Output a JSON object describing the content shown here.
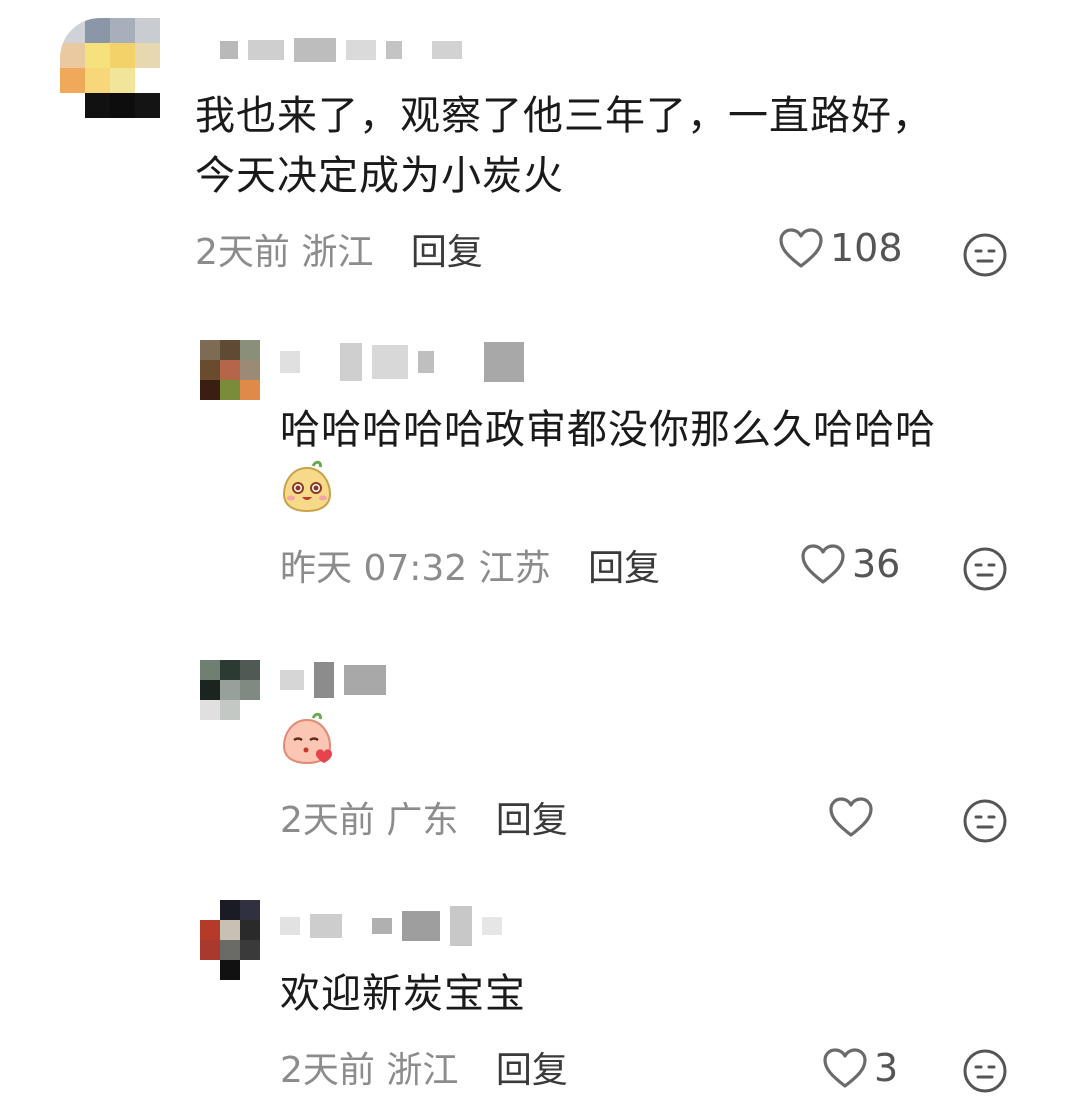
{
  "comments": [
    {
      "text": "我也来了，观察了他三年了，一直路好，今天决定成为小炭火",
      "time": "2天前",
      "location": "浙江",
      "reply_label": "回复",
      "likes": "108"
    },
    {
      "text": "哈哈哈哈哈政审都没你那么久哈哈哈",
      "time": "昨天 07:32",
      "location": "江苏",
      "reply_label": "回复",
      "likes": "36"
    },
    {
      "text": "",
      "time": "2天前",
      "location": "广东",
      "reply_label": "回复",
      "likes": ""
    },
    {
      "text": "欢迎新炭宝宝",
      "time": "2天前",
      "location": "浙江",
      "reply_label": "回复",
      "likes": "3"
    }
  ],
  "icons": {
    "like": "heart-outline-icon",
    "more": "neutral-face-icon",
    "emoji": "peach-mascot-sticker"
  }
}
